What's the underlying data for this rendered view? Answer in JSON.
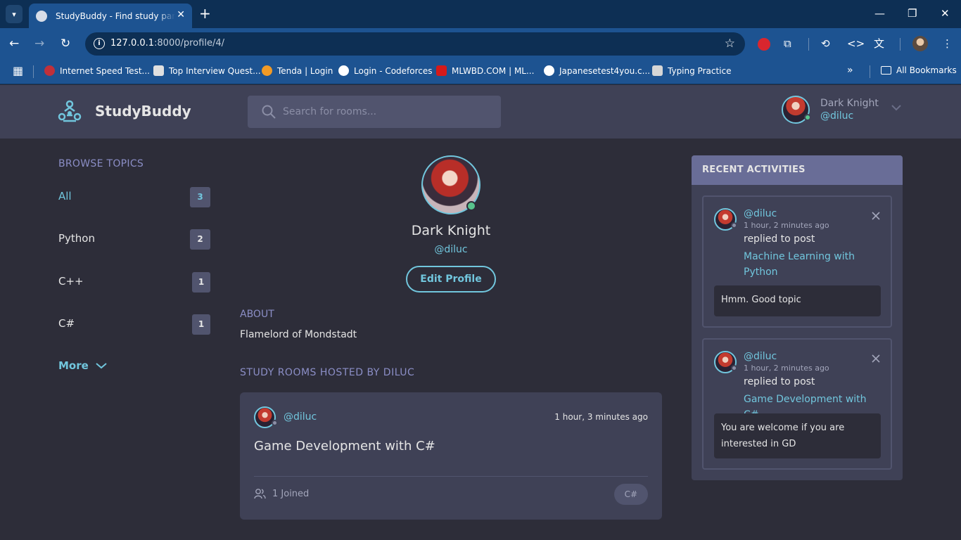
{
  "browser": {
    "tab_title": "StudyBuddy - Find study partners",
    "url_host": "127.0.0.1",
    "url_path": ":8000/profile/4/",
    "bookmarks": [
      "Internet Speed Test...",
      "Top Interview Quest...",
      "Tenda | Login",
      "Login - Codeforces",
      "MLWBD.COM | ML...",
      "Japanesetest4you.c...",
      "Typing Practice"
    ],
    "all_bookmarks": "All Bookmarks"
  },
  "header": {
    "brand": "StudyBuddy",
    "search_placeholder": "Search for rooms...",
    "user_name": "Dark Knight",
    "user_handle": "@diluc"
  },
  "sidebar": {
    "heading": "BROWSE TOPICS",
    "topics": [
      {
        "label": "All",
        "count": "3"
      },
      {
        "label": "Python",
        "count": "2"
      },
      {
        "label": "C++",
        "count": "1"
      },
      {
        "label": "C#",
        "count": "1"
      }
    ],
    "more_label": "More"
  },
  "profile": {
    "name": "Dark Knight",
    "handle": "@diluc",
    "edit_label": "Edit Profile",
    "about_heading": "ABOUT",
    "about_text": "Flamelord of Mondstadt",
    "rooms_heading": "STUDY ROOMS HOSTED BY DILUC"
  },
  "room": {
    "host": "@diluc",
    "time": "1 hour, 3 minutes ago",
    "title": "Game Development with C#",
    "joined": "1 Joined",
    "topic": "C#"
  },
  "recent": {
    "heading": "RECENT ACTIVITIES",
    "items": [
      {
        "user": "@diluc",
        "time": "1 hour, 2 minutes ago",
        "verb": "replied to post",
        "post": "Machine Learning with Python",
        "message": "Hmm. Good topic"
      },
      {
        "user": "@diluc",
        "time": "1 hour, 2 minutes ago",
        "verb": "replied to post",
        "post": "Game Development with C#",
        "message": "You are welcome if you are interested in GD"
      }
    ]
  },
  "colors": {
    "accent": "#71c6dd",
    "background": "#2d2d39",
    "surface": "#3f4156",
    "online": "#58c48d"
  }
}
